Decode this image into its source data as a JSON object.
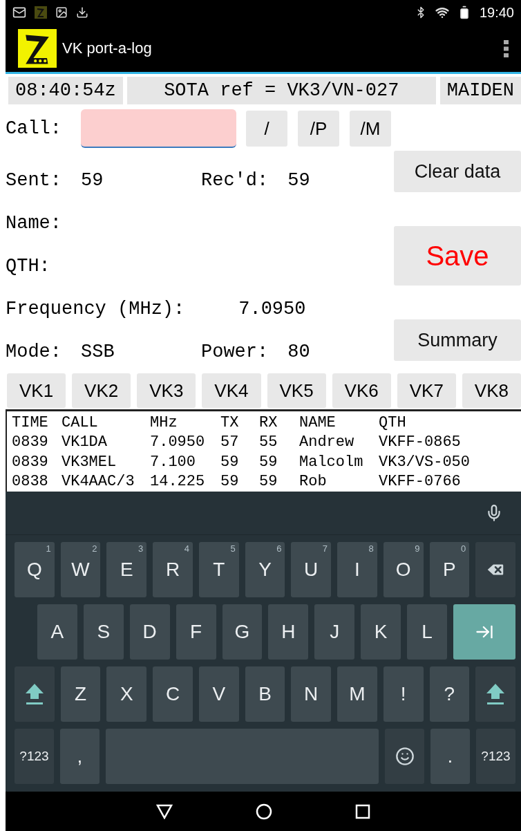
{
  "status_bar": {
    "time": "19:40"
  },
  "app_bar": {
    "title": "VK port-a-log"
  },
  "info": [
    "08:40:54z",
    "SOTA ref = VK3/VN-027",
    "MAIDEN"
  ],
  "call": {
    "label": "Call:",
    "buttons": [
      "/",
      "/P",
      "/M"
    ]
  },
  "fields": [
    {
      "kind": "pair",
      "items": [
        {
          "label": "Sent:",
          "value": "59"
        },
        {
          "label": "Rec'd:",
          "value": "59"
        }
      ]
    },
    {
      "kind": "single",
      "items": [
        {
          "label": "Name:"
        }
      ]
    },
    {
      "kind": "single",
      "items": [
        {
          "label": "QTH:"
        }
      ]
    },
    {
      "kind": "single",
      "items": [
        {
          "label": "Frequency (MHz):",
          "value": "7.0950"
        }
      ]
    },
    {
      "kind": "pair",
      "items": [
        {
          "label": "Mode:",
          "value": "SSB"
        },
        {
          "label": "Power:",
          "value": "80"
        }
      ]
    }
  ],
  "side_buttons": [
    {
      "label": "Clear data",
      "kind": "normal"
    },
    {
      "label": "Save",
      "kind": "primary"
    },
    {
      "label": "Summary",
      "kind": "normal"
    }
  ],
  "vk_buttons": [
    "VK1",
    "VK2",
    "VK3",
    "VK4",
    "VK5",
    "VK6",
    "VK7",
    "VK8"
  ],
  "log": {
    "columns": [
      "TIME",
      "CALL",
      "MHz",
      "TX",
      "RX",
      "NAME",
      "QTH"
    ],
    "rows": [
      [
        "0839",
        "VK1DA",
        "7.0950",
        "57",
        "55",
        "Andrew",
        "VKFF-0865"
      ],
      [
        "0839",
        "VK3MEL",
        "7.100",
        "59",
        "59",
        "Malcolm",
        "VK3/VS-050"
      ],
      [
        "0838",
        "VK4AAC/3",
        "14.225",
        "59",
        "59",
        "Rob",
        "VKFF-0766"
      ]
    ]
  },
  "keyboard": {
    "rows": [
      {
        "keys": [
          {
            "kind": "char",
            "label": "Q",
            "hint": "1"
          },
          {
            "kind": "char",
            "label": "W",
            "hint": "2"
          },
          {
            "kind": "char",
            "label": "E",
            "hint": "3"
          },
          {
            "kind": "char",
            "label": "R",
            "hint": "4"
          },
          {
            "kind": "char",
            "label": "T",
            "hint": "5"
          },
          {
            "kind": "char",
            "label": "Y",
            "hint": "6"
          },
          {
            "kind": "char",
            "label": "U",
            "hint": "7"
          },
          {
            "kind": "char",
            "label": "I",
            "hint": "8"
          },
          {
            "kind": "char",
            "label": "O",
            "hint": "9"
          },
          {
            "kind": "char",
            "label": "P",
            "hint": "0"
          },
          {
            "kind": "backspace"
          }
        ]
      },
      {
        "keys": [
          {
            "kind": "char",
            "label": "A"
          },
          {
            "kind": "char",
            "label": "S"
          },
          {
            "kind": "char",
            "label": "D"
          },
          {
            "kind": "char",
            "label": "F"
          },
          {
            "kind": "char",
            "label": "G"
          },
          {
            "kind": "char",
            "label": "H"
          },
          {
            "kind": "char",
            "label": "J"
          },
          {
            "kind": "char",
            "label": "K"
          },
          {
            "kind": "char",
            "label": "L"
          },
          {
            "kind": "tab"
          }
        ]
      },
      {
        "keys": [
          {
            "kind": "shift"
          },
          {
            "kind": "char",
            "label": "Z"
          },
          {
            "kind": "char",
            "label": "X"
          },
          {
            "kind": "char",
            "label": "C"
          },
          {
            "kind": "char",
            "label": "V"
          },
          {
            "kind": "char",
            "label": "B"
          },
          {
            "kind": "char",
            "label": "N"
          },
          {
            "kind": "char",
            "label": "M"
          },
          {
            "kind": "char",
            "label": "!"
          },
          {
            "kind": "char",
            "label": "?"
          },
          {
            "kind": "shift"
          }
        ]
      },
      {
        "keys": [
          {
            "kind": "small",
            "label": "?123"
          },
          {
            "kind": "char",
            "label": ","
          },
          {
            "kind": "space"
          },
          {
            "kind": "emoji"
          },
          {
            "kind": "char",
            "label": "."
          },
          {
            "kind": "small",
            "label": "?123"
          }
        ]
      }
    ]
  }
}
